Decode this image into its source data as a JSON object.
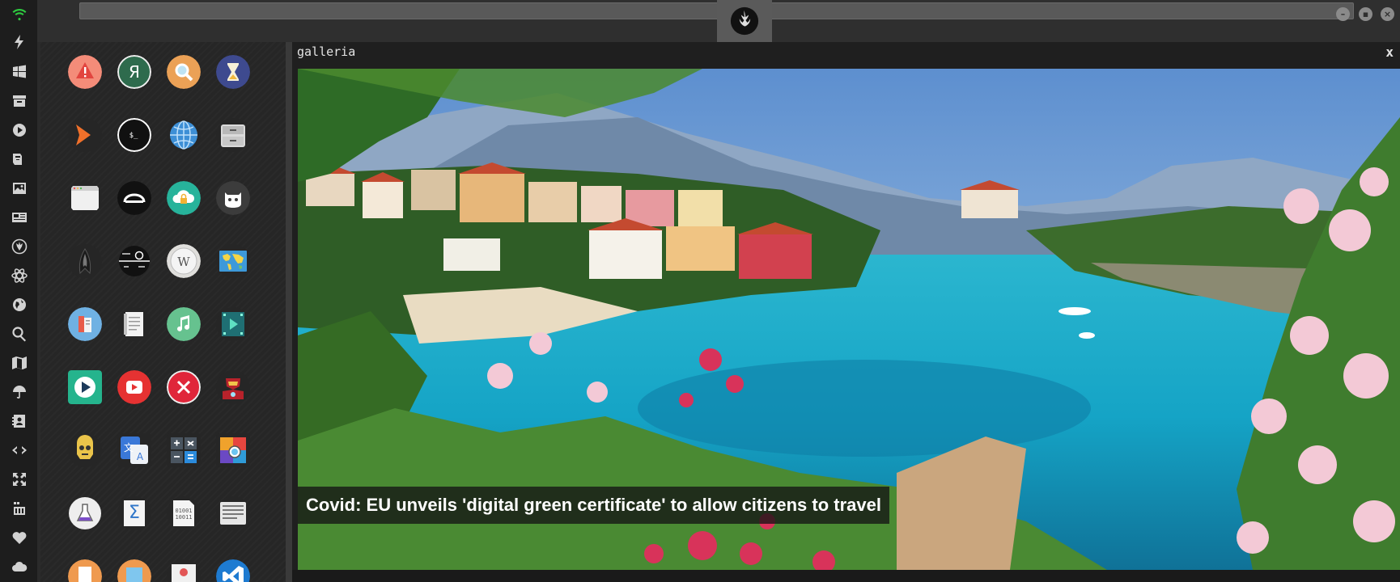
{
  "rail": {
    "icons": [
      "wifi-icon",
      "lightning-icon",
      "windows-icon",
      "archive-icon",
      "play-icon",
      "translate-icon",
      "image-icon",
      "news-icon",
      "rebel-alliance-icon",
      "atom-icon",
      "globe-icon",
      "search-icon",
      "map-icon",
      "umbrella-icon",
      "contacts-icon",
      "code-icon",
      "fullscreen-icon",
      "youtube-icon",
      "heart-icon",
      "cloud-icon"
    ]
  },
  "topbar": {
    "logo": "rebel-alliance-logo",
    "window_buttons": [
      "minimize-icon",
      "maximize-icon",
      "close-icon"
    ]
  },
  "apps": [
    "warning-icon",
    "yandex-icon",
    "search-icon",
    "hourglass-icon",
    "terminal-arrow-icon",
    "shell-icon",
    "web-browser-icon",
    "file-cabinet-icon",
    "window-icon",
    "headset-icon",
    "cloud-lock-icon",
    "github-icon",
    "starfleet-icon",
    "death-star-icon",
    "wikipedia-icon",
    "world-map-icon",
    "books-icon",
    "notes-icon",
    "music-icon",
    "video-player-icon",
    "media-player-icon",
    "youtube-player-icon",
    "cancel-icon",
    "iron-man-icon",
    "c3po-icon",
    "translator-icon",
    "calculator-icon",
    "color-picker-icon",
    "lab-flask-icon",
    "sigma-calculator-icon",
    "binary-file-icon",
    "text-editor-icon",
    "document-icon",
    "image-viewer-icon",
    "presentation-icon",
    "vscode-icon"
  ],
  "gallery": {
    "title": "galleria",
    "close_label": "x",
    "caption": "Covid: EU unveils 'digital green certificate' to allow citizens to travel"
  },
  "colors": {
    "accent_green": "#2ecc40",
    "background": "#2b2b2b"
  }
}
